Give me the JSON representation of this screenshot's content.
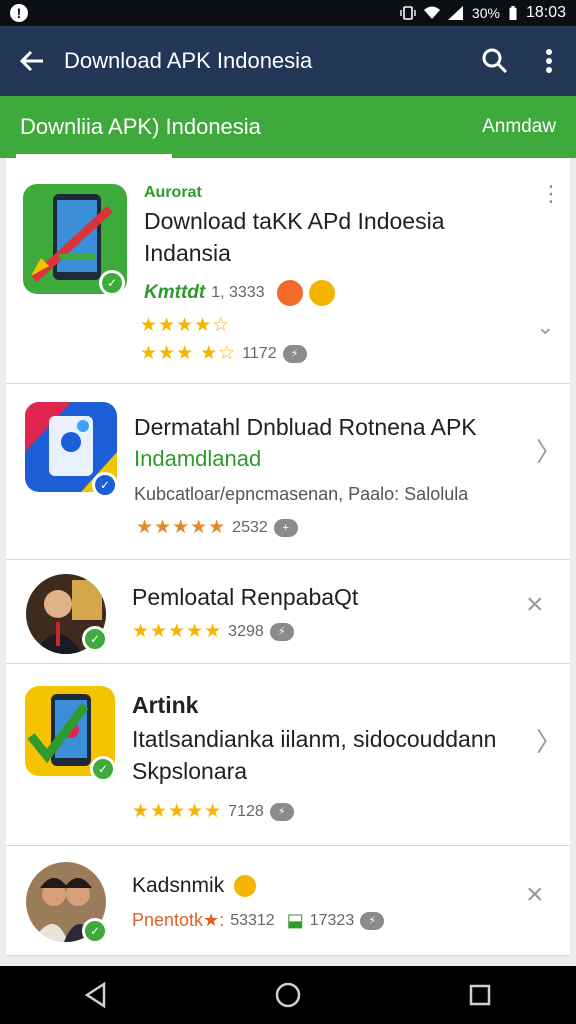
{
  "status": {
    "time": "18:03",
    "battery": "30%"
  },
  "appbar": {
    "title": "Download APK Indonesia"
  },
  "tabs": {
    "first": "Downliia APK) Indonesia",
    "second": "Anmdaw"
  },
  "items": [
    {
      "kicker": "Aurorat",
      "title_line1": "Download taKK APd Indoesia",
      "title_line2": "Indansia",
      "meta": "Kmttdt",
      "meta_count": "1, 3333",
      "rating1": "★★★★☆",
      "rating2": "★★★",
      "rating2_half": "★☆",
      "count": "1172"
    },
    {
      "title": "Dermatahl Dnbluad Rotnena APK",
      "subtitle": "Indamdlanad",
      "desc": "Kubcatloar/epncmasenan, Paalo: Salolula",
      "rating": "★★★★★",
      "count": "2532"
    },
    {
      "title": "Pemloatal RenpabaQt",
      "rating": "★★★★★",
      "count": "3298"
    },
    {
      "title": "Artink",
      "line2": "Itatlsandianka iilanm, sidocouddann",
      "line3": "Skpslonara",
      "rating": "★★★★★",
      "count": "7128"
    },
    {
      "title": "Kadsnmik",
      "meta": "Pnentotk★:",
      "meta_count": "53312",
      "meta_count2": "17323"
    }
  ],
  "colors": {
    "appbar": "#223756",
    "tabbar": "#3faa3c",
    "accent_green": "#2f9a2d"
  }
}
